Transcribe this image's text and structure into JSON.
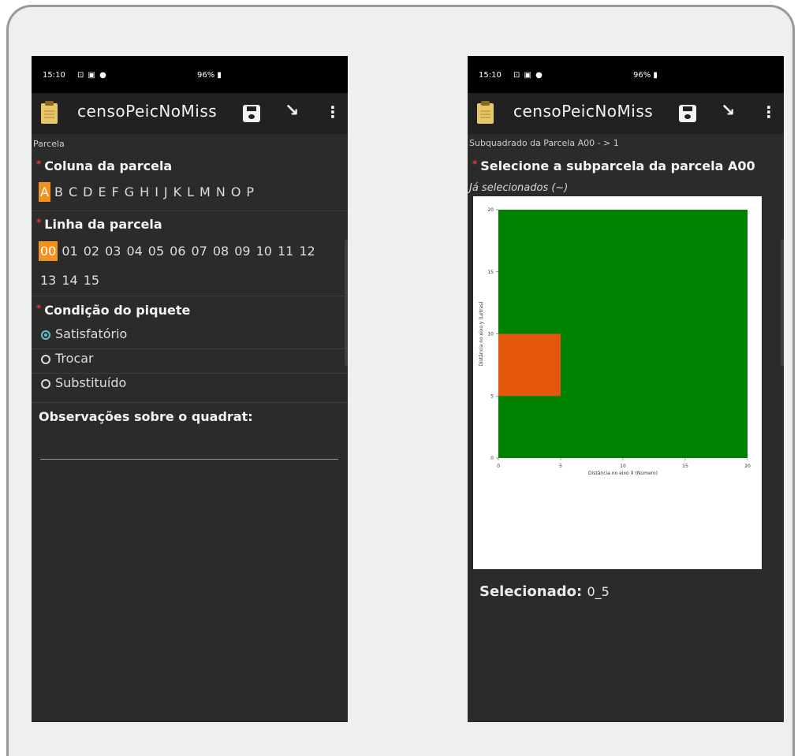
{
  "status_bar": {
    "time": "15:10",
    "right": "96% ▮",
    "icons": "⊡ ▣ ●"
  },
  "left_screen": {
    "app_title": "censoPeicNoMiss",
    "section": "Parcela",
    "column_label": "Coluna da parcela",
    "columns": [
      "A",
      "B",
      "C",
      "D",
      "E",
      "F",
      "G",
      "H",
      "I",
      "J",
      "K",
      "L",
      "M",
      "N",
      "O",
      "P"
    ],
    "selected_column": "A",
    "row_label": "Linha da parcela",
    "rows_line1": [
      "00",
      "01",
      "02",
      "03",
      "04",
      "05",
      "06",
      "07",
      "08",
      "09",
      "10",
      "11",
      "12"
    ],
    "rows_line2": [
      "13",
      "14",
      "15"
    ],
    "selected_row": "00",
    "condition_label": "Condição do piquete",
    "conditions": [
      "Satisfatório",
      "Trocar",
      "Substituído"
    ],
    "selected_condition": "Satisfatório",
    "observations_label": "Observações sobre o quadrat:",
    "observations_value": ""
  },
  "right_screen": {
    "app_title": "censoPeicNoMiss",
    "section": "Subquadrado da Parcela A00 - > 1",
    "question": "Selecione a subparcela da parcela A00",
    "hint": "Já selecionados (~)",
    "selected_label": "Selecionado:",
    "selected_value": "0_5"
  },
  "colors": {
    "plot_fill": "#008000",
    "selected_fill": "#e4570a",
    "accent": "#f2921b",
    "radio": "#5fc3c6"
  },
  "chart_data": {
    "type": "heatmap",
    "xlabel": "Distância no eixo X (Número)",
    "ylabel": "Distância no eixo y (Letras)",
    "xlim": [
      0,
      20
    ],
    "ylim": [
      0,
      20
    ],
    "xticks": [
      0,
      5,
      10,
      15,
      20
    ],
    "yticks": [
      0,
      5,
      10,
      15,
      20
    ],
    "regions": [
      {
        "name": "plot",
        "x": [
          0,
          20
        ],
        "y": [
          0,
          20
        ],
        "color": "#008000"
      },
      {
        "name": "selected",
        "x": [
          0,
          5
        ],
        "y": [
          5,
          10
        ],
        "color": "#e4570a"
      }
    ]
  }
}
